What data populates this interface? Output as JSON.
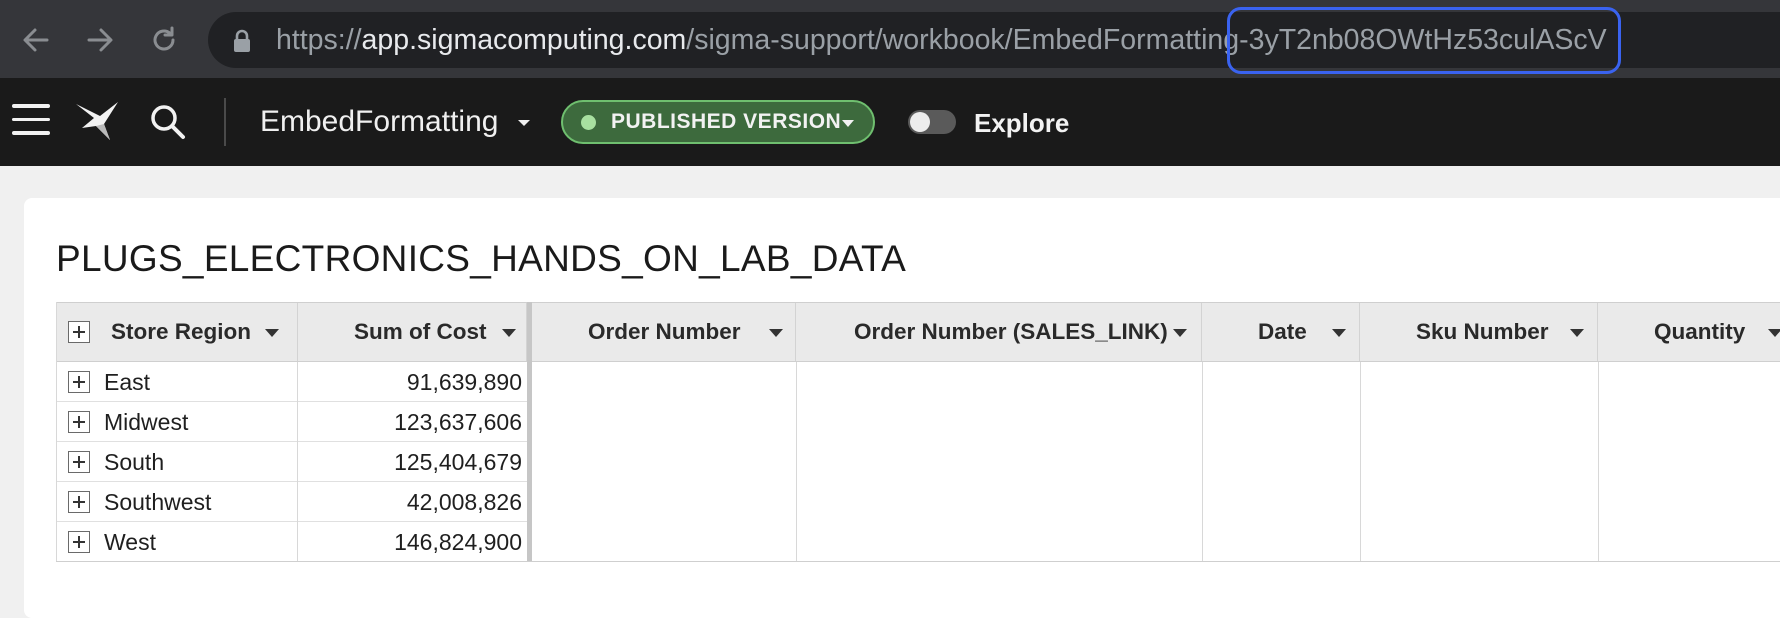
{
  "browser": {
    "url_scheme": "https://",
    "url_host": "app.sigmacomputing.com",
    "url_path": "/sigma-support/workbook/EmbedFormatting",
    "url_id": "-3yT2nb08OWtHz53culAScV",
    "highlight_color": "#3a63f0"
  },
  "appbar": {
    "workbook_title": "EmbedFormatting",
    "version_label": "PUBLISHED VERSION",
    "explore_label": "Explore",
    "explore_enabled": false,
    "version_color": "#3d6a3d"
  },
  "page": {
    "title": "PLUGS_ELECTRONICS_HANDS_ON_LAB_DATA"
  },
  "table": {
    "columns": [
      "Store Region",
      "Sum of Cost",
      "Order Number",
      "Order Number (SALES_LINK)",
      "Date",
      "Sku Number",
      "Quantity"
    ],
    "rows": [
      {
        "region": "East",
        "cost": "91,639,890"
      },
      {
        "region": "Midwest",
        "cost": "123,637,606"
      },
      {
        "region": "South",
        "cost": "125,404,679"
      },
      {
        "region": "Southwest",
        "cost": "42,008,826"
      },
      {
        "region": "West",
        "cost": "146,824,900"
      }
    ]
  }
}
